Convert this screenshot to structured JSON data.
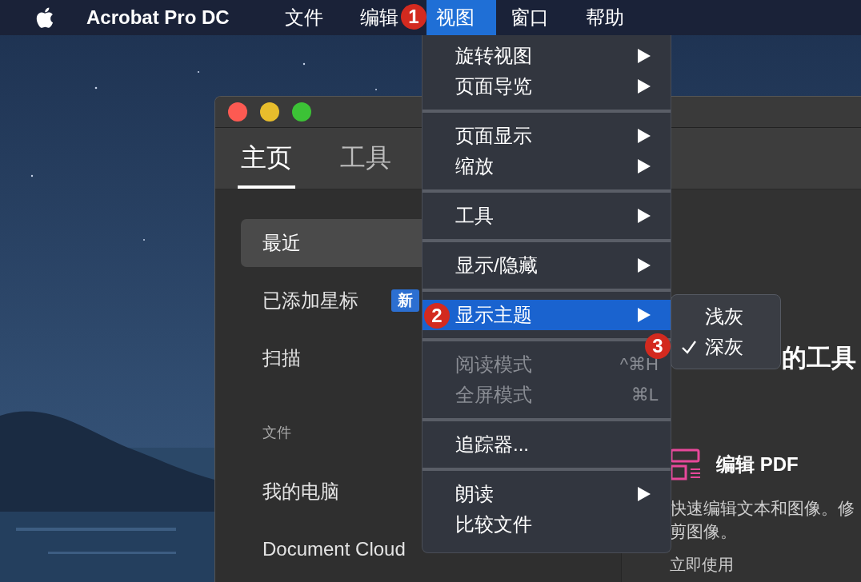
{
  "menu_bar": {
    "app_name": "Acrobat Pro DC",
    "menus": [
      {
        "label": "文件",
        "selected": false
      },
      {
        "label": "编辑",
        "selected": false
      },
      {
        "label": "视图",
        "selected": true
      },
      {
        "label": "窗口",
        "selected": false
      },
      {
        "label": "帮助",
        "selected": false
      }
    ]
  },
  "window": {
    "tabs": [
      {
        "label": "主页",
        "selected": true
      },
      {
        "label": "工具",
        "selected": false
      }
    ],
    "sidebar": {
      "items": [
        {
          "label": "最近",
          "selected": true
        },
        {
          "label": "已添加星标",
          "selected": false,
          "badge": "新"
        },
        {
          "label": "扫描",
          "selected": false
        }
      ],
      "section": {
        "label": "文件",
        "items": [
          {
            "label": "我的电脑",
            "selected": false
          },
          {
            "label": "Document Cloud",
            "selected": false
          }
        ]
      }
    },
    "content": {
      "heading": "的工具",
      "tool": {
        "title": "编辑 PDF",
        "description": [
          "快速编辑文本和图像。修",
          "剪图像。"
        ]
      },
      "action": "立即使用"
    }
  },
  "view_menu": {
    "groups": [
      [
        {
          "label": "旋转视图",
          "has_submenu": true,
          "disabled": false,
          "selected": false
        },
        {
          "label": "页面导览",
          "has_submenu": true,
          "disabled": false,
          "selected": false
        }
      ],
      [
        {
          "label": "页面显示",
          "has_submenu": true,
          "disabled": false,
          "selected": false
        },
        {
          "label": "缩放",
          "has_submenu": true,
          "disabled": false,
          "selected": false
        }
      ],
      [
        {
          "label": "工具",
          "has_submenu": true,
          "disabled": false,
          "selected": false
        }
      ],
      [
        {
          "label": "显示/隐藏",
          "has_submenu": true,
          "disabled": false,
          "selected": false
        }
      ],
      [
        {
          "label": "显示主题",
          "has_submenu": true,
          "disabled": false,
          "selected": true
        }
      ],
      [
        {
          "label": "阅读模式",
          "has_submenu": false,
          "disabled": true,
          "selected": false,
          "shortcut": "^⌘H"
        },
        {
          "label": "全屏模式",
          "has_submenu": false,
          "disabled": true,
          "selected": false,
          "shortcut": "⌘L"
        }
      ],
      [
        {
          "label": "追踪器...",
          "has_submenu": false,
          "disabled": false,
          "selected": false
        }
      ],
      [
        {
          "label": "朗读",
          "has_submenu": true,
          "disabled": false,
          "selected": false
        },
        {
          "label": "比较文件",
          "has_submenu": false,
          "disabled": false,
          "selected": false
        }
      ]
    ]
  },
  "theme_submenu": {
    "items": [
      {
        "label": "浅灰",
        "checked": false
      },
      {
        "label": "深灰",
        "checked": true
      }
    ]
  },
  "step_badges": [
    "1",
    "2",
    "3"
  ]
}
